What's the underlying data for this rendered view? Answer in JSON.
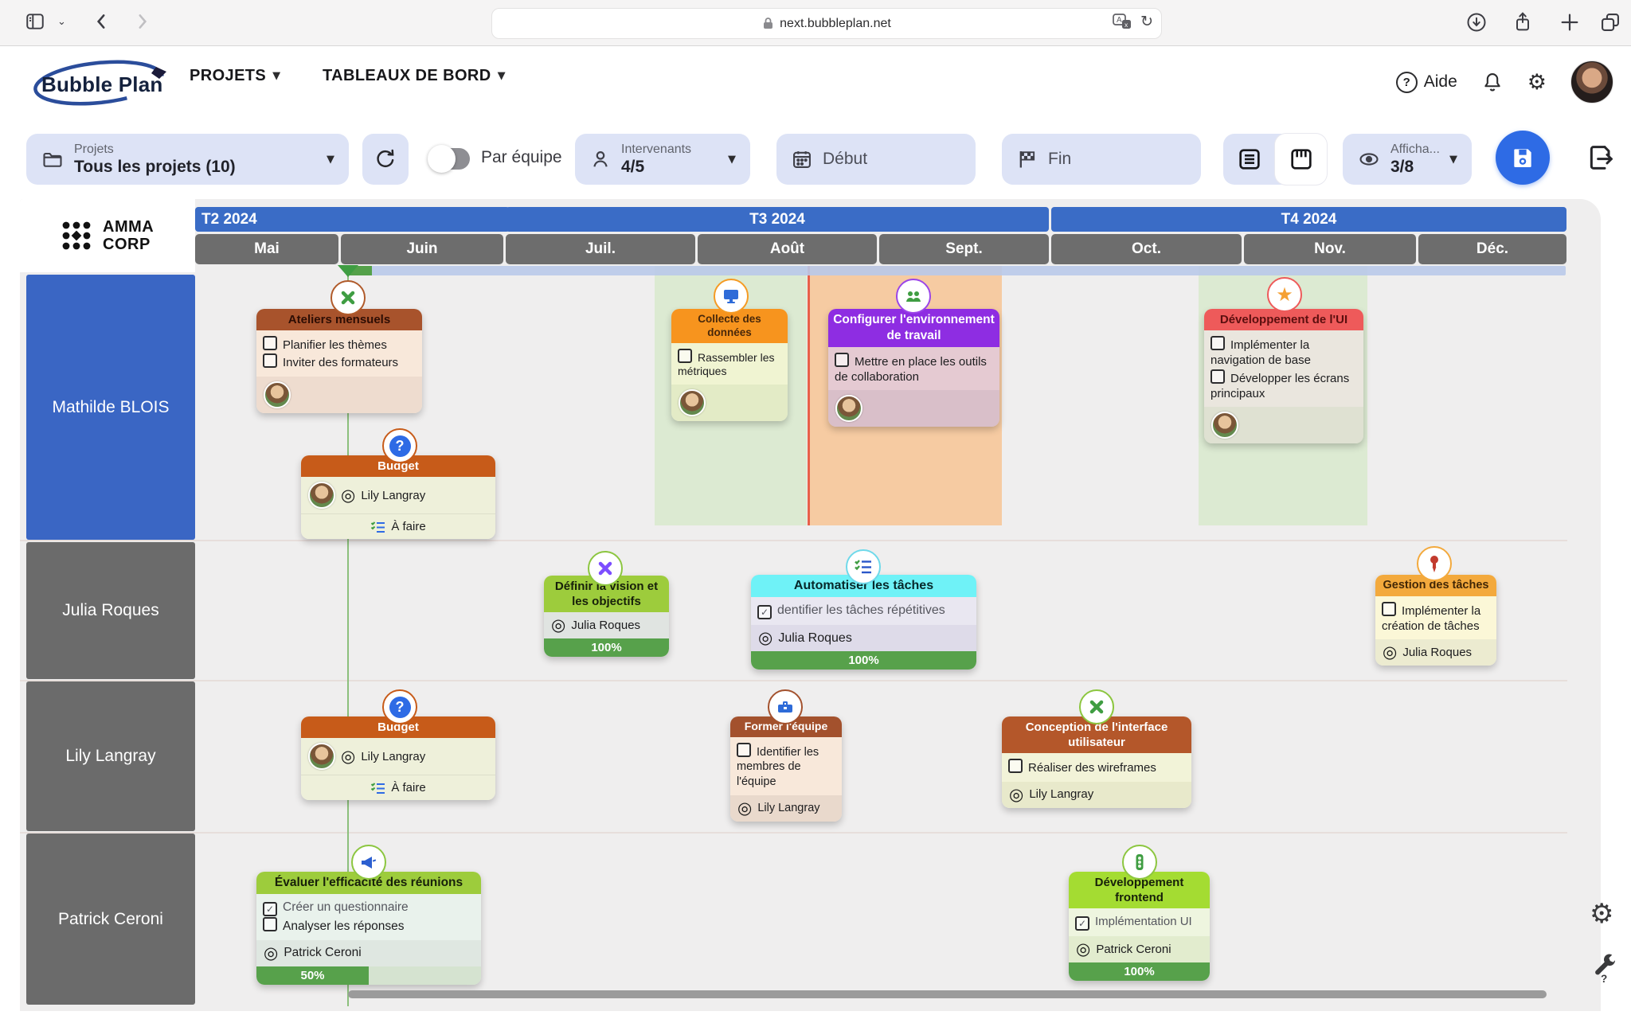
{
  "browser": {
    "url": "next.bubbleplan.net"
  },
  "header": {
    "brand": "Bubble Plan",
    "menu_projects": "PROJETS",
    "menu_dashboards": "TABLEAUX DE BORD",
    "help_label": "Aide"
  },
  "toolbar": {
    "projects_label": "Projets",
    "projects_value": "Tous les projets (10)",
    "team_toggle_label": "Par équipe",
    "intervenants_label": "Intervenants",
    "intervenants_value": "4/5",
    "start_label": "Début",
    "end_label": "Fin",
    "display_label": "Afficha...",
    "display_value": "3/8"
  },
  "company": {
    "line1": "AMMA",
    "line2": "CORP"
  },
  "timeline": {
    "quarters": [
      "T2 2024",
      "T3 2024",
      "T4 2024"
    ],
    "months": [
      "Mai",
      "Juin",
      "Juil.",
      "Août",
      "Sept.",
      "Oct.",
      "Nov.",
      "Déc."
    ]
  },
  "lanes": [
    "Mathilde BLOIS",
    "Julia Roques",
    "Lily Langray",
    "Patrick Ceroni"
  ],
  "cards": {
    "ateliers": {
      "title": "Ateliers mensuels",
      "task1": "Planifier les thèmes",
      "task2": "Inviter des formateurs"
    },
    "budget": {
      "title": "Budget",
      "assignee": "Lily Langray",
      "todo": "À faire"
    },
    "collecte": {
      "title": "Collecte des données",
      "task1": "Rassembler les métriques"
    },
    "configurer": {
      "title": "Configurer l'environnement de travail",
      "task1": "Mettre en place les outils de collaboration"
    },
    "dev_ui": {
      "title": "Développement de l'UI",
      "task1": "Implémenter la navigation de base",
      "task2": "Développer les écrans principaux"
    },
    "definir": {
      "title": "Définir la vision et les objectifs",
      "assignee": "Julia Roques",
      "progress": "100%"
    },
    "automatiser": {
      "title": "Automatiser les tâches",
      "task1": "dentifier les tâches répétitives",
      "assignee": "Julia Roques",
      "progress": "100%"
    },
    "gestion": {
      "title": "Gestion des tâches",
      "task1": "Implémenter la création de tâches",
      "assignee": "Julia Roques"
    },
    "former": {
      "title": "Former l'équipe",
      "task1": "Identifier les membres de l'équipe",
      "assignee": "Lily Langray"
    },
    "conception": {
      "title": "Conception de l'interface utilisateur",
      "task1": "Réaliser des wireframes",
      "assignee": "Lily Langray"
    },
    "evaluer": {
      "title": "Évaluer l'efficacité des réunions",
      "task1": "Créer un questionnaire",
      "task2": "Analyser les réponses",
      "assignee": "Patrick Ceroni",
      "progress": "50%"
    },
    "dev_frontend": {
      "title": "Développement frontend",
      "task1": "Implémentation UI",
      "assignee": "Patrick Ceroni",
      "progress": "100%"
    }
  },
  "colors": {
    "quarter_blue": "#3a6cc6",
    "month_gray": "#6d6d6d",
    "lane_blue": "#3a66c4",
    "lane_gray": "#6b6b6b",
    "save_blue": "#2e6be5",
    "pill_bg": "#dde3f6",
    "progress_green": "#57a14b",
    "today_green": "#55a14a",
    "band_green": "#dcead2",
    "band_orange": "#f6cba2",
    "hdr_ateliers": "#a8532c",
    "hdr_budget": "#c75b19",
    "hdr_collecte": "#f7941e",
    "hdr_configurer": "#8e2de2",
    "hdr_dev_ui": "#ee5a5a",
    "hdr_definir": "#9dcc3c",
    "hdr_automatiser": "#6ff2f7",
    "hdr_gestion": "#f3a93c",
    "hdr_former": "#a3512d",
    "hdr_conception": "#b4572a",
    "hdr_evaluer": "#9dcc3c",
    "hdr_dev_frontend": "#a4dc32"
  }
}
